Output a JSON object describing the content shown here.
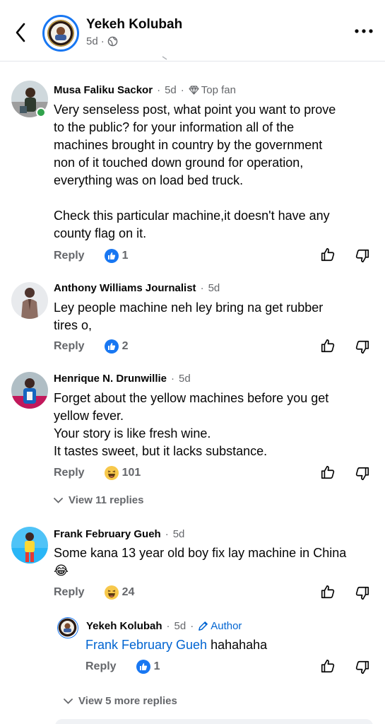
{
  "header": {
    "name": "Yekeh Kolubah",
    "age": "5d",
    "separator": "·"
  },
  "comments": [
    {
      "author": "Musa Faliku Sackor",
      "time": "5d",
      "badge": "Top fan",
      "lines": [
        "Very senseless post, what point you want to prove",
        "to the public? for your information all of the",
        "machines brought in country by the government",
        "non of it touched down ground for operation,",
        "everything was on load bed truck.",
        "",
        "Check this particular machine,it doesn't have any",
        "county flag on it."
      ],
      "reply_label": "Reply",
      "reaction": "like",
      "reaction_count": "1"
    },
    {
      "author": "Anthony Williams Journalist",
      "time": "5d",
      "lines": [
        "Ley people machine neh ley bring na get rubber",
        "tires o,"
      ],
      "reply_label": "Reply",
      "reaction": "like",
      "reaction_count": "2"
    },
    {
      "author": "Henrique N. Drunwillie",
      "time": "5d",
      "lines": [
        "Forget about the yellow machines before you get",
        "yellow fever.",
        "Your story is like fresh wine.",
        "It tastes sweet, but it lacks substance."
      ],
      "reply_label": "Reply",
      "reaction": "haha",
      "reaction_count": "101",
      "view_replies": "View 11 replies"
    },
    {
      "author": "Frank February Gueh",
      "time": "5d",
      "lines": [
        "Some kana 13 year old boy fix lay machine in China"
      ],
      "emoji_line": "😂",
      "reply_label": "Reply",
      "reaction": "haha",
      "reaction_count": "24"
    }
  ],
  "reply": {
    "author": "Yekeh Kolubah",
    "time": "5d",
    "badge": "Author",
    "mention": "Frank February Gueh",
    "text": "hahahaha",
    "reply_label": "Reply",
    "reaction": "like",
    "reaction_count": "1"
  },
  "more_replies": "View 5 more replies",
  "colors": {
    "accent": "#1877f2",
    "link": "#0064d1",
    "secondary_text": "#65676b",
    "online": "#31a24c"
  }
}
